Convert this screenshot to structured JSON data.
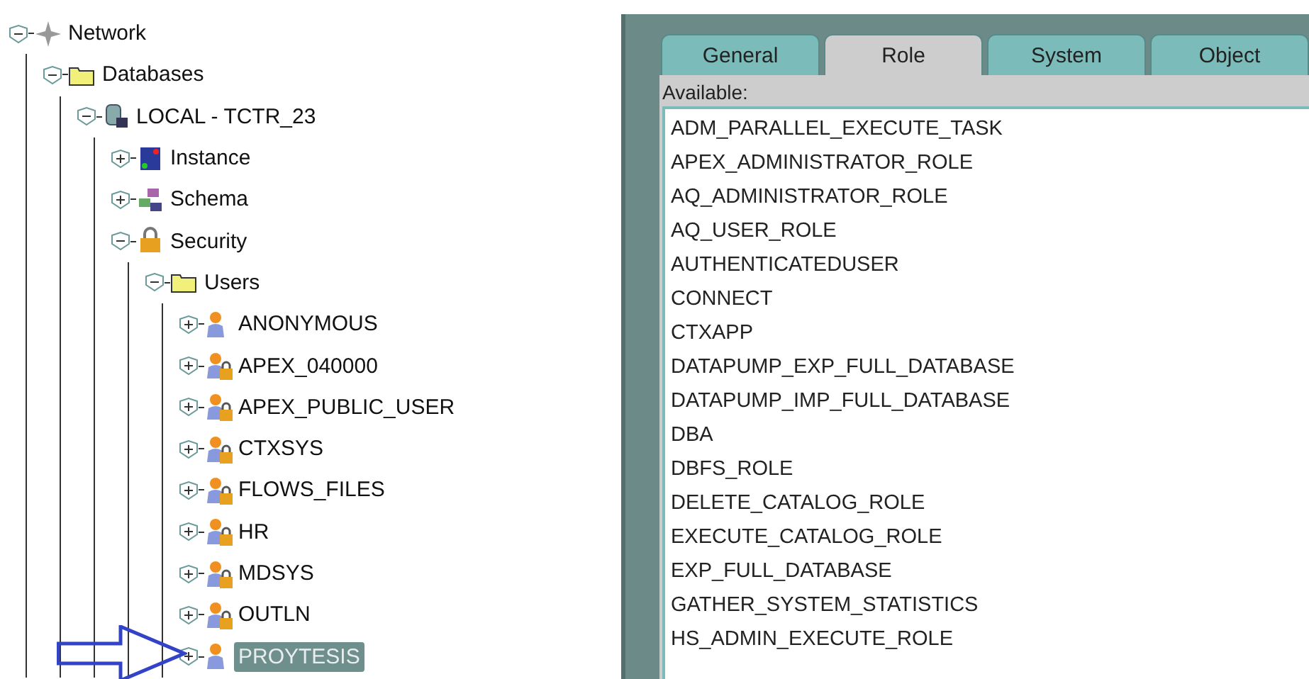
{
  "tree": [
    {
      "label": "Network",
      "kind": "network",
      "expanded": true,
      "selected": false,
      "children": [
        {
          "label": "Databases",
          "kind": "folder",
          "expanded": true,
          "selected": false,
          "children": [
            {
              "label": "LOCAL - TCTR_23",
              "kind": "database",
              "expanded": true,
              "selected": false,
              "children": [
                {
                  "label": "Instance",
                  "kind": "instance",
                  "expanded": false,
                  "selected": false
                },
                {
                  "label": "Schema",
                  "kind": "schema",
                  "expanded": false,
                  "selected": false
                },
                {
                  "label": "Security",
                  "kind": "security",
                  "expanded": true,
                  "selected": false,
                  "children": [
                    {
                      "label": "Users",
                      "kind": "folder",
                      "expanded": true,
                      "selected": false,
                      "children": [
                        {
                          "label": "ANONYMOUS",
                          "kind": "user",
                          "expanded": false,
                          "selected": false
                        },
                        {
                          "label": "APEX_040000",
                          "kind": "locked-user",
                          "expanded": false,
                          "selected": false
                        },
                        {
                          "label": "APEX_PUBLIC_USER",
                          "kind": "locked-user",
                          "expanded": false,
                          "selected": false
                        },
                        {
                          "label": "CTXSYS",
                          "kind": "locked-user",
                          "expanded": false,
                          "selected": false
                        },
                        {
                          "label": "FLOWS_FILES",
                          "kind": "locked-user",
                          "expanded": false,
                          "selected": false
                        },
                        {
                          "label": "HR",
                          "kind": "locked-user",
                          "expanded": false,
                          "selected": false
                        },
                        {
                          "label": "MDSYS",
                          "kind": "locked-user",
                          "expanded": false,
                          "selected": false
                        },
                        {
                          "label": "OUTLN",
                          "kind": "locked-user",
                          "expanded": false,
                          "selected": false
                        },
                        {
                          "label": "PROYTESIS",
                          "kind": "user",
                          "expanded": false,
                          "selected": true
                        }
                      ]
                    }
                  ]
                }
              ]
            }
          ]
        }
      ]
    }
  ],
  "tabs": [
    {
      "label": "General",
      "selected": false
    },
    {
      "label": "Role",
      "selected": true
    },
    {
      "label": "System",
      "selected": false
    },
    {
      "label": "Object",
      "selected": false
    }
  ],
  "available_label": "Available:",
  "available_roles": [
    "ADM_PARALLEL_EXECUTE_TASK",
    "APEX_ADMINISTRATOR_ROLE",
    "AQ_ADMINISTRATOR_ROLE",
    "AQ_USER_ROLE",
    "AUTHENTICATEDUSER",
    "CONNECT",
    "CTXAPP",
    "DATAPUMP_EXP_FULL_DATABASE",
    "DATAPUMP_IMP_FULL_DATABASE",
    "DBA",
    "DBFS_ROLE",
    "DELETE_CATALOG_ROLE",
    "EXECUTE_CATALOG_ROLE",
    "EXP_FULL_DATABASE",
    "GATHER_SYSTEM_STATISTICS",
    "HS_ADMIN_EXECUTE_ROLE"
  ]
}
